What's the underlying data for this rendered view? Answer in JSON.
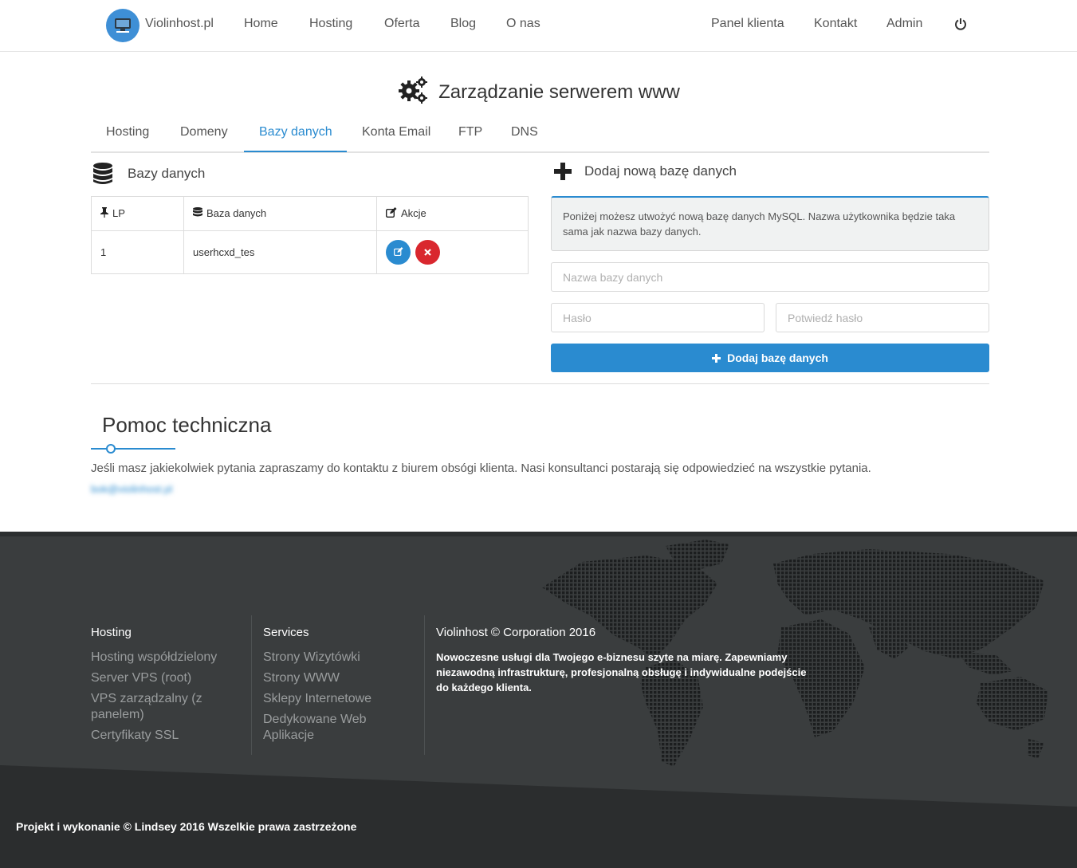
{
  "nav": {
    "brand": "Violinhost.pl",
    "left": [
      "Home",
      "Hosting",
      "Oferta",
      "Blog",
      "O nas"
    ],
    "right": [
      "Panel klienta",
      "Kontakt",
      "Admin"
    ]
  },
  "page": {
    "title": "Zarządzanie serwerem www"
  },
  "tabs": [
    "Hosting",
    "Domeny",
    "Bazy danych",
    "Konta Email",
    "FTP",
    "DNS"
  ],
  "databases": {
    "heading": "Bazy danych",
    "columns": [
      "LP",
      "Baza danych",
      "Akcje"
    ],
    "rows": [
      {
        "lp": "1",
        "name": "userhcxd_tes"
      }
    ]
  },
  "add_form": {
    "heading": "Dodaj nową bazę danych",
    "info": "Poniżej możesz utwożyć nową bazę danych MySQL. Nazwa użytkownika będzie taka sama jak nazwa bazy danych.",
    "name_placeholder": "Nazwa bazy danych",
    "password_placeholder": "Hasło",
    "confirm_placeholder": "Potwiedź hasło",
    "submit": "Dodaj bazę danych"
  },
  "help": {
    "title": "Pomoc techniczna",
    "text": "Jeśli masz jakiekolwiek pytania zapraszamy do kontaktu z biurem obsógi klienta. Nasi konsultanci postarają się odpowiedzieć na wszystkie pytania.",
    "email": "bok@violinhost.pl"
  },
  "footer": {
    "col1": {
      "title": "Hosting",
      "links": [
        "Hosting współdzielony",
        "Server VPS (root)",
        "VPS zarządzalny (z panelem)",
        "Certyfikaty SSL"
      ]
    },
    "col2": {
      "title": "Services",
      "links": [
        "Strony Wizytówki",
        "Strony WWW",
        "Sklepy Internetowe",
        "Dedykowane Web Aplikacje"
      ]
    },
    "col3": {
      "title": "Violinhost © Corporation 2016",
      "desc": "Nowoczesne usługi dla Twojego e-biznesu szyte na miarę. Zapewniamy niezawodną infrastrukturę, profesjonalną obsługę i indywidualne podejście do każdego klienta."
    },
    "copyright": "Projekt i wykonanie © Lindsey 2016 Wszelkie prawa zastrzeżone"
  },
  "colors": {
    "primary": "#2a8bd0",
    "danger": "#d9272e",
    "footer_bg": "#3a3d3e",
    "footer_dark": "#2c2f30"
  }
}
